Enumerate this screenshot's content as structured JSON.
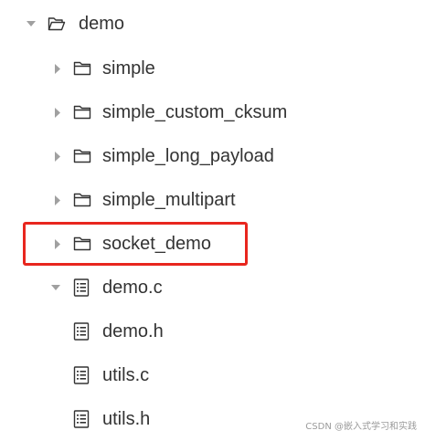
{
  "tree": {
    "root": {
      "label": "demo",
      "expanded": true,
      "icon": "folder-open-icon"
    },
    "folders": [
      {
        "label": "simple",
        "icon": "folder-icon",
        "expanded": false
      },
      {
        "label": "simple_custom_cksum",
        "icon": "folder-icon",
        "expanded": false
      },
      {
        "label": "simple_long_payload",
        "icon": "folder-icon",
        "expanded": false
      },
      {
        "label": "simple_multipart",
        "icon": "folder-icon",
        "expanded": false
      },
      {
        "label": "socket_demo",
        "icon": "folder-icon",
        "expanded": false,
        "highlighted": true
      }
    ],
    "files": [
      {
        "label": "demo.c",
        "icon": "file-text-icon",
        "has_outline": true,
        "expanded": true
      },
      {
        "label": "demo.h",
        "icon": "file-text-icon"
      },
      {
        "label": "utils.c",
        "icon": "file-text-icon"
      },
      {
        "label": "utils.h",
        "icon": "file-text-icon"
      }
    ]
  },
  "colors": {
    "text": "#333333",
    "chevron": "#a0a0a0",
    "icon": "#333333",
    "highlight_border": "#e8261e",
    "watermark": "#9a9a9a"
  },
  "watermark": "CSDN @嵌入式学习和实践"
}
